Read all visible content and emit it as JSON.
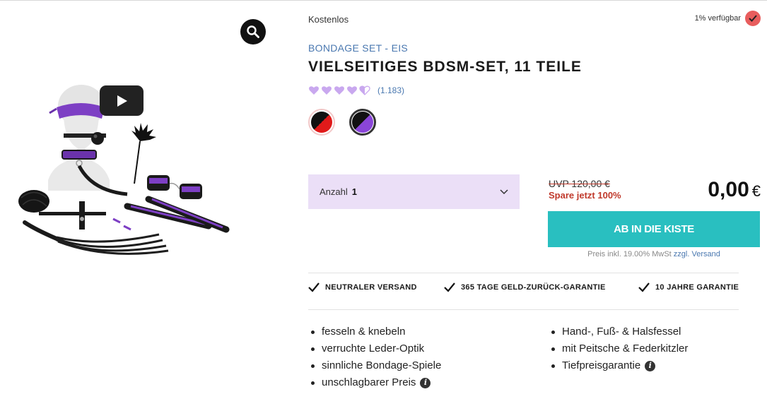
{
  "gallery": {
    "zoom_icon": "magnifier-icon",
    "play_icon": "play-icon"
  },
  "product": {
    "shipping_note": "Kostenlos",
    "availability": "1% verfügbar",
    "breadcrumb": {
      "category": "BONDAGE SET",
      "separator": "-",
      "subcategory": "EIS"
    },
    "title": "VIELSEITIGES BDSM-SET, 11 TEILE",
    "rating": {
      "stars": 4.5,
      "max": 5,
      "count": "(1.183)"
    },
    "swatches": [
      {
        "name": "black-red",
        "colors": [
          "#111111",
          "#e01a1a"
        ]
      },
      {
        "name": "black-purple",
        "colors": [
          "#111111",
          "#8a45d8"
        ]
      }
    ],
    "quantity": {
      "label": "Anzahl",
      "value": "1"
    },
    "price": {
      "uvp": "UVP 120,00 €",
      "savings": "Spare jetzt 100%",
      "amount": "0,00",
      "currency": "€"
    },
    "cart_button": "AB IN DIE KISTE",
    "tax_note": {
      "text": "Preis inkl. 19.00% MwSt",
      "link1": "zzgl.",
      "link2": "Versand"
    },
    "guarantees": [
      "NEUTRALER VERSAND",
      "365 TAGE GELD-ZURÜCK-GARANTIE",
      "10 JAHRE GARANTIE"
    ],
    "features_left": [
      "fesseln & knebeln",
      "verruchte Leder-Optik",
      "sinnliche Bondage-Spiele",
      "unschlagbarer Preis"
    ],
    "features_right": [
      "Hand-, Fuß- & Halsfessel",
      "mit Peitsche & Federkitzler",
      "Tiefpreisgarantie"
    ]
  },
  "colors": {
    "accent_teal": "#29bfc0",
    "link_blue": "#4a78b0",
    "sale_red": "#c0392b",
    "qty_bg": "#ebdff7",
    "rating_heart": "#c9a8ef"
  }
}
